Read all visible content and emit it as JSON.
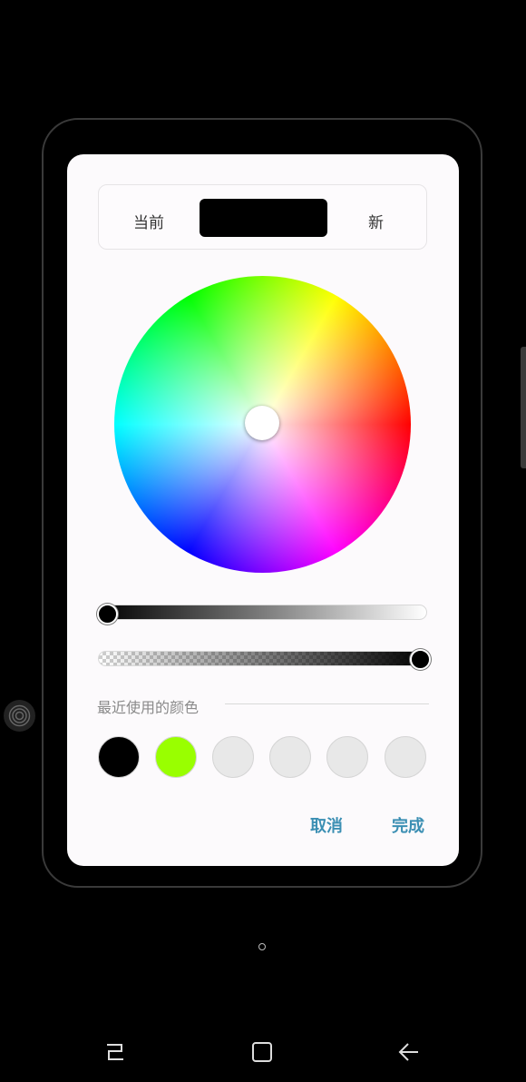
{
  "picker": {
    "current_label": "当前",
    "new_label": "新",
    "current_color": "#000000",
    "brightness_level": 0,
    "alpha_level": 1.0
  },
  "recent": {
    "title": "最近使用的颜色",
    "colors": [
      "#000000",
      "#99ff00",
      "#e8e8e8",
      "#e8e8e8",
      "#e8e8e8",
      "#e8e8e8"
    ]
  },
  "actions": {
    "cancel_label": "取消",
    "done_label": "完成"
  },
  "accent_color": "#3b8fb3",
  "icons": {
    "recents": "recent-apps-icon",
    "home": "home-square-icon",
    "back": "back-arrow-icon",
    "fingerprint": "fingerprint-icon"
  }
}
